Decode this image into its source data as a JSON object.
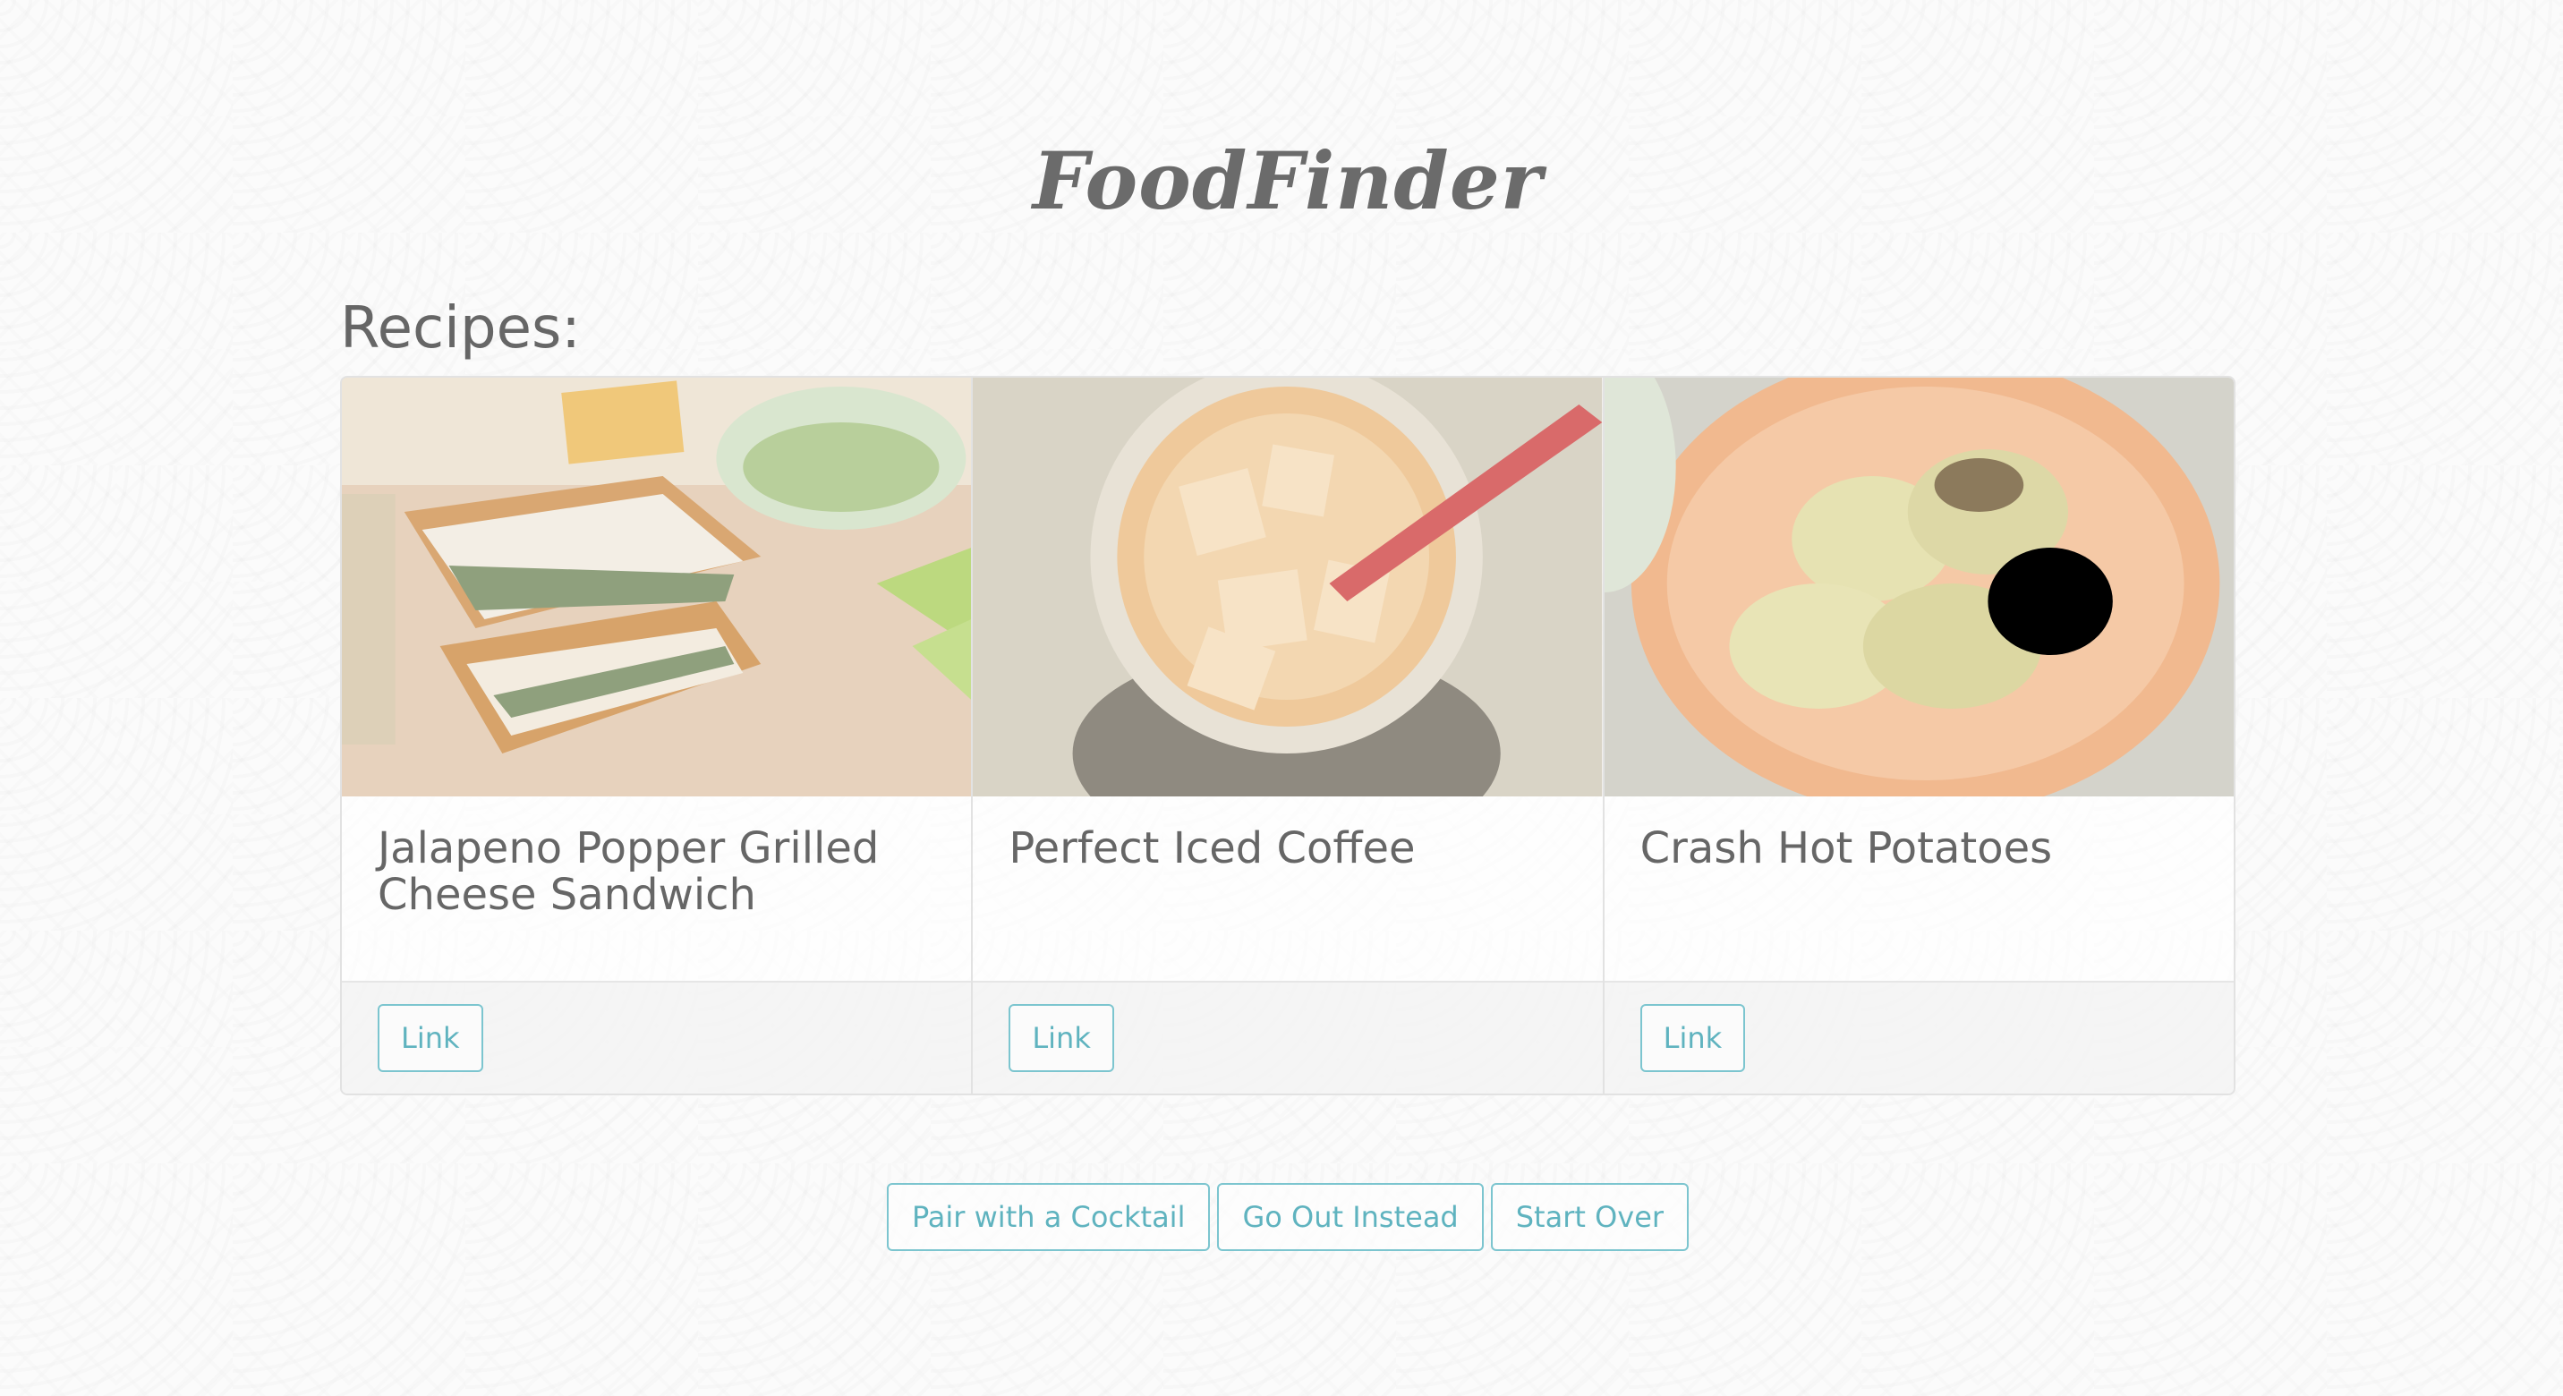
{
  "app": {
    "title": "FoodFinder"
  },
  "section": {
    "heading": "Recipes:"
  },
  "recipes": [
    {
      "title": "Jalapeno Popper Grilled Cheese Sandwich",
      "link_label": "Link",
      "image": "grilled-cheese-photo"
    },
    {
      "title": "Perfect Iced Coffee",
      "link_label": "Link",
      "image": "iced-coffee-photo"
    },
    {
      "title": "Crash Hot Potatoes",
      "link_label": "Link",
      "image": "potatoes-photo"
    }
  ],
  "actions": {
    "cocktail_label": "Pair with a Cocktail",
    "go_out_label": "Go Out Instead",
    "start_over_label": "Start Over"
  },
  "colors": {
    "accent": "#5fb3bf",
    "text": "#666666",
    "border": "#e2e2e2"
  }
}
